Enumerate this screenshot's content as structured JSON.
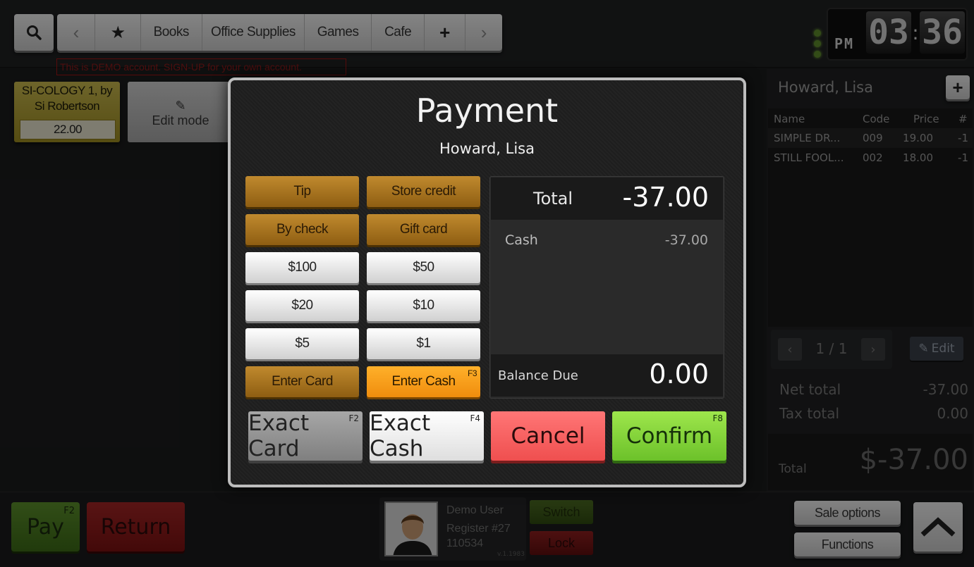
{
  "topbar": {
    "categories": [
      "Books",
      "Office Supplies",
      "Games",
      "Cafe"
    ],
    "demo_note": "This is DEMO account. SIGN-UP for your own account."
  },
  "clock": {
    "ampm": "PM",
    "hours": "03",
    "minutes": "36"
  },
  "products": {
    "tile1": {
      "name": "SI-COLOGY 1, by Si Robertson",
      "price": "22.00"
    },
    "tile2": {
      "label": "Edit mode"
    }
  },
  "sale": {
    "customer": "Howard, Lisa",
    "columns": [
      "Name",
      "Code",
      "Price",
      "#"
    ],
    "lines": [
      {
        "name": "SIMPLE DR...",
        "code": "009",
        "price": "19.00",
        "qty": "-1"
      },
      {
        "name": "STILL FOOL...",
        "code": "002",
        "price": "18.00",
        "qty": "-1"
      }
    ],
    "pager": "1 / 1",
    "edit_label": "Edit",
    "net_total_label": "Net total",
    "net_total": "-37.00",
    "tax_total_label": "Tax total",
    "tax_total": "0.00",
    "total_label": "Total",
    "total": "$-37.00"
  },
  "payment": {
    "title": "Payment",
    "customer": "Howard, Lisa",
    "buttons": {
      "tip": "Tip",
      "store_credit": "Store credit",
      "by_check": "By check",
      "gift_card": "Gift card",
      "d100": "$100",
      "d50": "$50",
      "d20": "$20",
      "d10": "$10",
      "d5": "$5",
      "d1": "$1",
      "enter_card": "Enter Card",
      "enter_cash": "Enter Cash",
      "enter_cash_key": "F3"
    },
    "total_label": "Total",
    "total": "-37.00",
    "cash_label": "Cash",
    "cash": "-37.00",
    "balance_label": "Balance Due",
    "balance": "0.00",
    "actions": {
      "exact_card": "Exact Card",
      "exact_card_key": "F2",
      "exact_cash": "Exact Cash",
      "exact_cash_key": "F4",
      "cancel": "Cancel",
      "confirm": "Confirm",
      "confirm_key": "F8"
    }
  },
  "bottom": {
    "pay": "Pay",
    "pay_key": "F2",
    "return": "Return",
    "user_name": "Demo User",
    "register": "Register #27",
    "register_id": "110534",
    "version": "v.1.1983",
    "switch": "Switch",
    "lock": "Lock",
    "sale_options": "Sale options",
    "functions": "Functions"
  }
}
